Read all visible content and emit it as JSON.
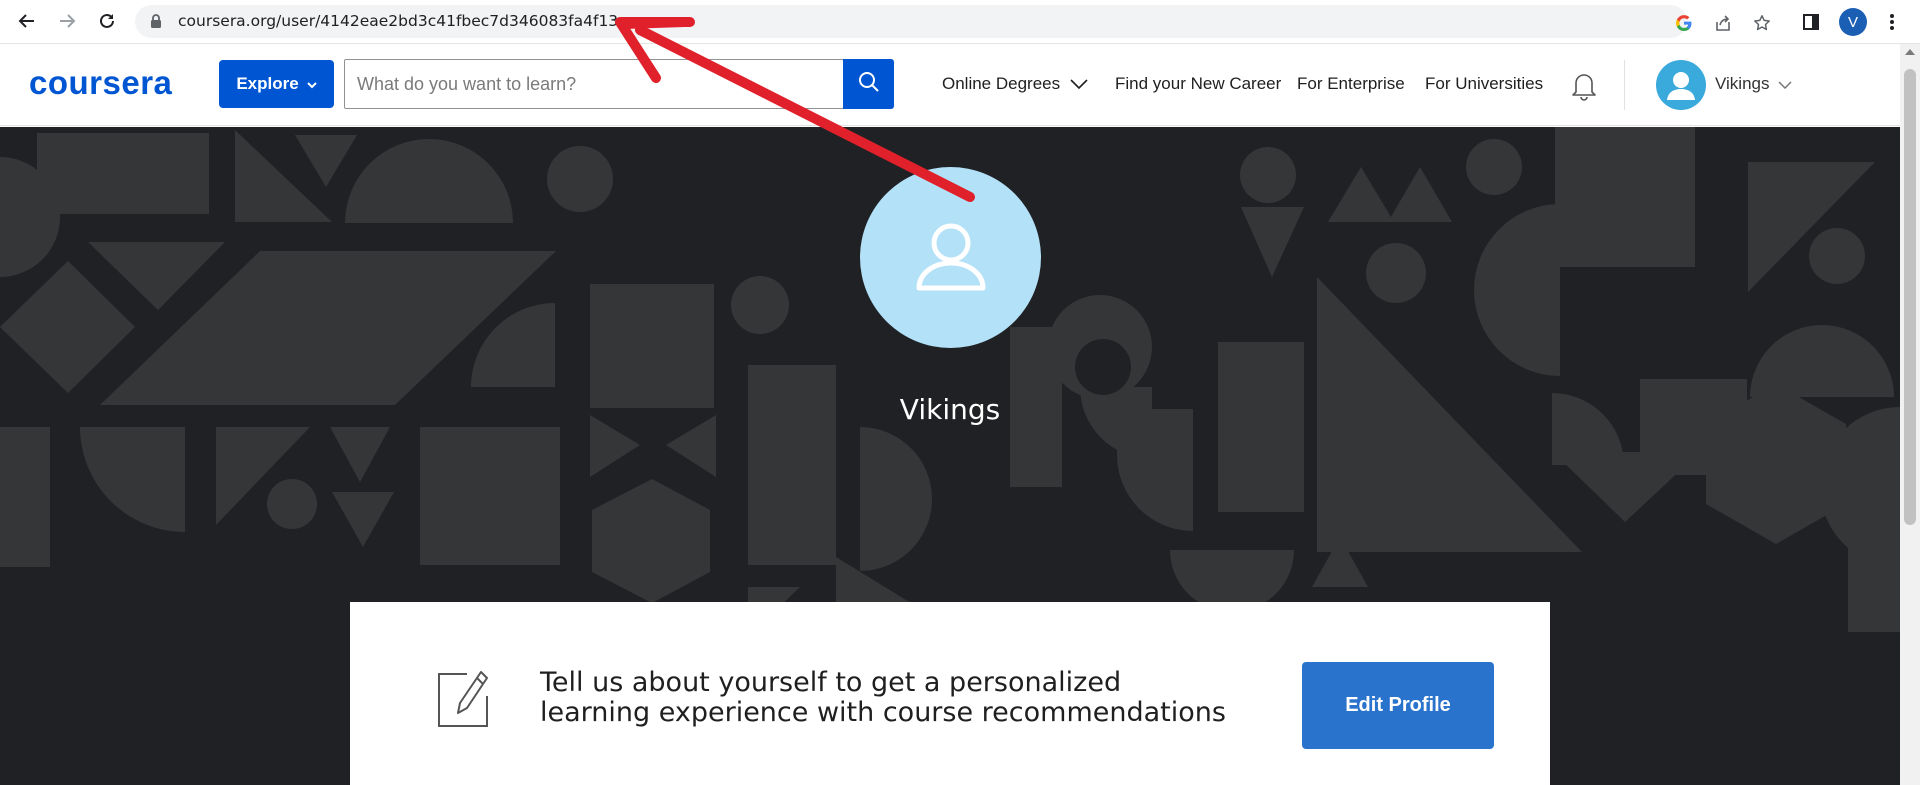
{
  "browser": {
    "url": "coursera.org/user/4142eae2bd3c41fbec7d346083fa4f13",
    "profile_initial": "V",
    "icons": [
      "back-icon",
      "forward-icon",
      "reload-icon",
      "lock-icon",
      "google-icon",
      "share-icon",
      "star-icon",
      "sidepanel-icon",
      "menu-icon"
    ]
  },
  "header": {
    "logo": "coursera",
    "explore_label": "Explore",
    "search_placeholder": "What do you want to learn?",
    "nav": {
      "online_degrees": "Online Degrees",
      "find_career": "Find your New Career",
      "enterprise": "For Enterprise",
      "universities": "For Universities"
    },
    "user_name": "Vikings"
  },
  "profile": {
    "name": "Vikings"
  },
  "card": {
    "prompt_line1": "Tell us about yourself to get a personalized",
    "prompt_line2": "learning experience with course recommendations",
    "edit_label": "Edit Profile"
  },
  "colors": {
    "brand_blue": "#0056d2",
    "edit_blue": "#2a73cc",
    "hero_bg": "#1f2124",
    "hero_shape": "#353638",
    "avatar_light": "#b3e1f7",
    "avatar_header": "#3aa9db",
    "arrow_red": "#e0202a",
    "chrome_avatar": "#1a5fb4"
  }
}
